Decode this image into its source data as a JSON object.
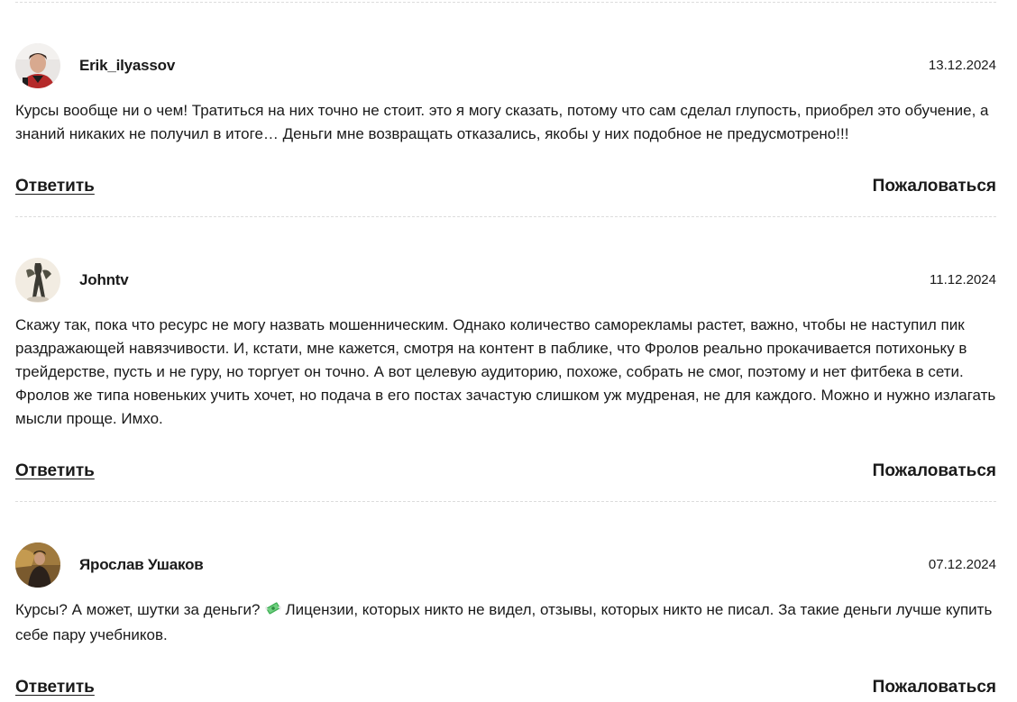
{
  "comments": [
    {
      "author": "Erik_ilyassov",
      "date": "13.12.2024",
      "text": "Курсы вообще ни о чем! Тратиться на них точно не стоит. это я могу сказать, потому что сам сделал глупость, приобрел это обучение, а знаний никаких не получил в итоге… Деньги мне возвращать отказались, якобы у них подобное не предусмотрено!!!",
      "reply_label": "Ответить",
      "report_label": "Пожаловаться"
    },
    {
      "author": "Johntv",
      "date": "11.12.2024",
      "text": "Скажу так, пока что ресурс не могу назвать мошенническим. Однако количество саморекламы растет, важно, чтобы не наступил пик раздражающей навязчивости. И, кстати, мне кажется, смотря на контент в паблике, что Фролов реально прокачивается потихоньку в трейдерстве, пусть и не гуру, но торгует он точно. А вот целевую аудиторию, похоже, собрать не смог, поэтому и нет фитбека в сети. Фролов же типа новеньких учить хочет, но подача в его постах зачастую слишком уж мудреная, не для каждого. Можно и нужно излагать мысли проще. Имхо.",
      "reply_label": "Ответить",
      "report_label": "Пожаловаться"
    },
    {
      "author": "Ярослав Ушаков",
      "date": "07.12.2024",
      "text_before_emoji": "Курсы? А может, шутки за деньги?",
      "emoji_icon": "money-with-wings-icon",
      "text_after_emoji": "Лицензии, которых никто не видел, отзывы, которых никто не писал. За такие деньги лучше купить себе пару учебников.",
      "reply_label": "Ответить",
      "report_label": "Пожаловаться"
    }
  ],
  "colors": {
    "text": "#1a1a1a",
    "divider": "#dcdcdc",
    "background": "#ffffff"
  }
}
